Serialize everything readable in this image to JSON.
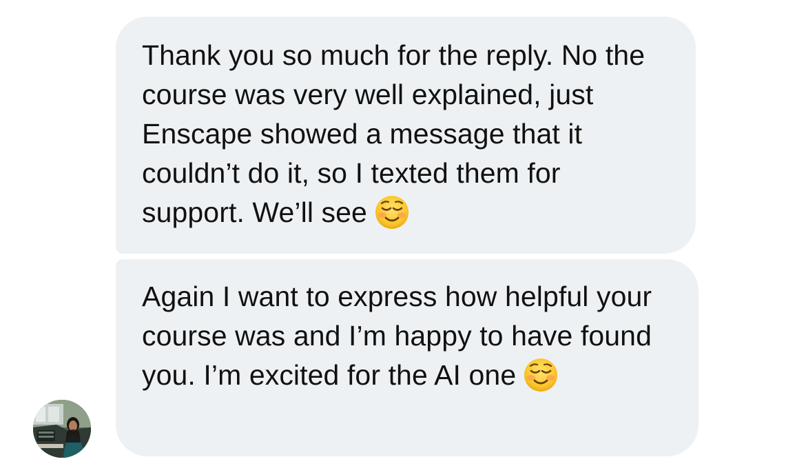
{
  "conversation": {
    "messages": [
      {
        "text": "Thank you so much for the reply. No the course was very well explained, just Enscape showed a message that it couldn’t do it, so I texted them for support. We’ll see",
        "emoji": "smiling-face-icon"
      },
      {
        "text": "Again I want to express how helpful your course was and I’m happy to have found you. I’m excited for the AI one",
        "emoji": "smiling-face-icon"
      }
    ],
    "bubble_color": "#eef1f3",
    "text_color": "#111111"
  },
  "sender": {
    "avatar": "profile-photo"
  }
}
